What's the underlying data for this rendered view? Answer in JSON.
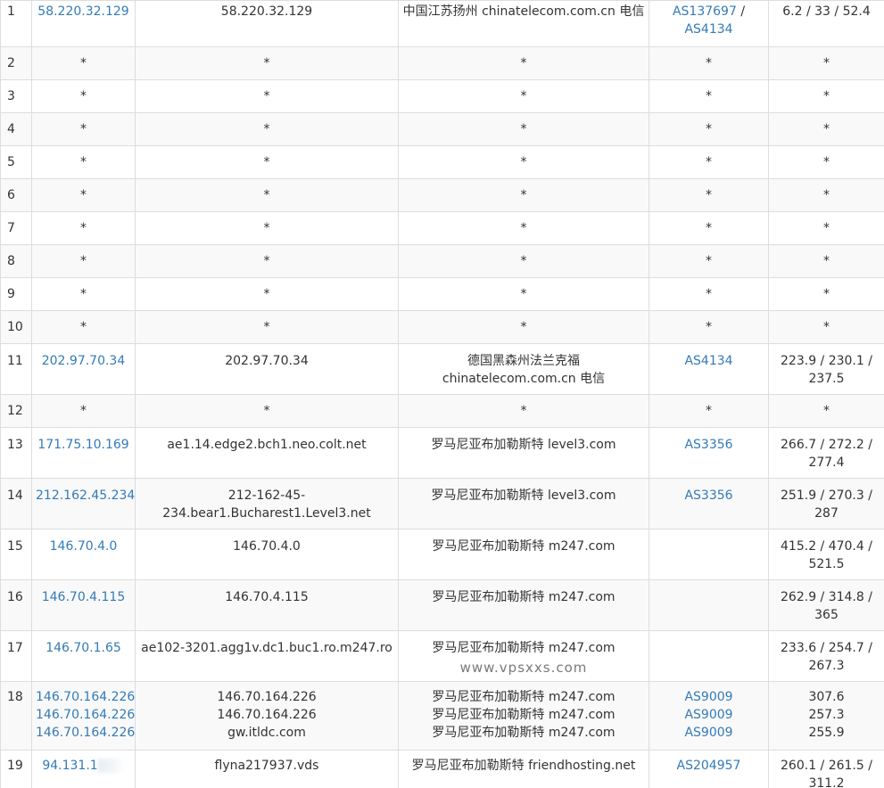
{
  "hops": [
    {
      "hop": "1",
      "ips": [
        "58.220.32.129"
      ],
      "hosts": [
        "58.220.32.129"
      ],
      "locations": [
        "中国江苏扬州 chinatelecom.com.cn 电信"
      ],
      "asns": [
        "AS137697",
        "AS4134"
      ],
      "asn_sep": " /",
      "latency": [
        "6.2 / 33 / 52.4"
      ]
    },
    {
      "hop": "2",
      "ips": [
        "*"
      ],
      "hosts": [
        "*"
      ],
      "locations": [
        "*"
      ],
      "asns": [
        "*"
      ],
      "latency": [
        "*"
      ]
    },
    {
      "hop": "3",
      "ips": [
        "*"
      ],
      "hosts": [
        "*"
      ],
      "locations": [
        "*"
      ],
      "asns": [
        "*"
      ],
      "latency": [
        "*"
      ]
    },
    {
      "hop": "4",
      "ips": [
        "*"
      ],
      "hosts": [
        "*"
      ],
      "locations": [
        "*"
      ],
      "asns": [
        "*"
      ],
      "latency": [
        "*"
      ]
    },
    {
      "hop": "5",
      "ips": [
        "*"
      ],
      "hosts": [
        "*"
      ],
      "locations": [
        "*"
      ],
      "asns": [
        "*"
      ],
      "latency": [
        "*"
      ]
    },
    {
      "hop": "6",
      "ips": [
        "*"
      ],
      "hosts": [
        "*"
      ],
      "locations": [
        "*"
      ],
      "asns": [
        "*"
      ],
      "latency": [
        "*"
      ]
    },
    {
      "hop": "7",
      "ips": [
        "*"
      ],
      "hosts": [
        "*"
      ],
      "locations": [
        "*"
      ],
      "asns": [
        "*"
      ],
      "latency": [
        "*"
      ]
    },
    {
      "hop": "8",
      "ips": [
        "*"
      ],
      "hosts": [
        "*"
      ],
      "locations": [
        "*"
      ],
      "asns": [
        "*"
      ],
      "latency": [
        "*"
      ]
    },
    {
      "hop": "9",
      "ips": [
        "*"
      ],
      "hosts": [
        "*"
      ],
      "locations": [
        "*"
      ],
      "asns": [
        "*"
      ],
      "latency": [
        "*"
      ]
    },
    {
      "hop": "10",
      "ips": [
        "*"
      ],
      "hosts": [
        "*"
      ],
      "locations": [
        "*"
      ],
      "asns": [
        "*"
      ],
      "latency": [
        "*"
      ]
    },
    {
      "hop": "11",
      "ips": [
        "202.97.70.34"
      ],
      "hosts": [
        "202.97.70.34"
      ],
      "locations": [
        "德国黑森州法兰克福",
        "chinatelecom.com.cn 电信"
      ],
      "asns": [
        "AS4134"
      ],
      "latency": [
        "223.9 / 230.1 /",
        "237.5"
      ]
    },
    {
      "hop": "12",
      "ips": [
        "*"
      ],
      "hosts": [
        "*"
      ],
      "locations": [
        "*"
      ],
      "asns": [
        "*"
      ],
      "latency": [
        "*"
      ]
    },
    {
      "hop": "13",
      "ips": [
        "171.75.10.169"
      ],
      "hosts": [
        "ae1.14.edge2.bch1.neo.colt.net"
      ],
      "locations": [
        "罗马尼亚布加勒斯特 level3.com"
      ],
      "asns": [
        "AS3356"
      ],
      "latency": [
        "266.7 / 272.2 /",
        "277.4"
      ]
    },
    {
      "hop": "14",
      "ips": [
        "212.162.45.234"
      ],
      "hosts": [
        "212-162-45-",
        "234.bear1.Bucharest1.Level3.net"
      ],
      "locations": [
        "罗马尼亚布加勒斯特 level3.com"
      ],
      "asns": [
        "AS3356"
      ],
      "latency": [
        "251.9 / 270.3 /",
        "287"
      ]
    },
    {
      "hop": "15",
      "ips": [
        "146.70.4.0"
      ],
      "hosts": [
        "146.70.4.0"
      ],
      "locations": [
        "罗马尼亚布加勒斯特 m247.com"
      ],
      "asns": [],
      "latency": [
        "415.2 / 470.4 /",
        "521.5"
      ]
    },
    {
      "hop": "16",
      "ips": [
        "146.70.4.115"
      ],
      "hosts": [
        "146.70.4.115"
      ],
      "locations": [
        "罗马尼亚布加勒斯特 m247.com"
      ],
      "asns": [],
      "latency": [
        "262.9 / 314.8 /",
        "365"
      ]
    },
    {
      "hop": "17",
      "ips": [
        "146.70.1.65"
      ],
      "hosts": [
        "ae102-3201.agg1v.dc1.buc1.ro.m247.ro"
      ],
      "locations": [
        "罗马尼亚布加勒斯特 m247.com"
      ],
      "watermark": "www.vpsxxs.com",
      "asns": [],
      "latency": [
        "233.6 / 254.7 /",
        "267.3"
      ]
    },
    {
      "hop": "18",
      "ips": [
        "146.70.164.226",
        "146.70.164.226",
        "146.70.164.226"
      ],
      "hosts": [
        "146.70.164.226",
        "146.70.164.226",
        "gw.itldc.com"
      ],
      "locations": [
        "罗马尼亚布加勒斯特 m247.com",
        "罗马尼亚布加勒斯特 m247.com",
        "罗马尼亚布加勒斯特 m247.com"
      ],
      "asns": [
        "AS9009",
        "AS9009",
        "AS9009"
      ],
      "latency": [
        "307.6",
        "257.3",
        "255.9"
      ]
    },
    {
      "hop": "19",
      "ips": [
        "94.131.1"
      ],
      "hosts": [
        "flyna217937.vds"
      ],
      "locations": [
        "罗马尼亚布加勒斯特 friendhosting.net"
      ],
      "asns": [
        "AS204957"
      ],
      "latency": [
        "260.1 / 261.5 /",
        "311.2"
      ]
    }
  ]
}
